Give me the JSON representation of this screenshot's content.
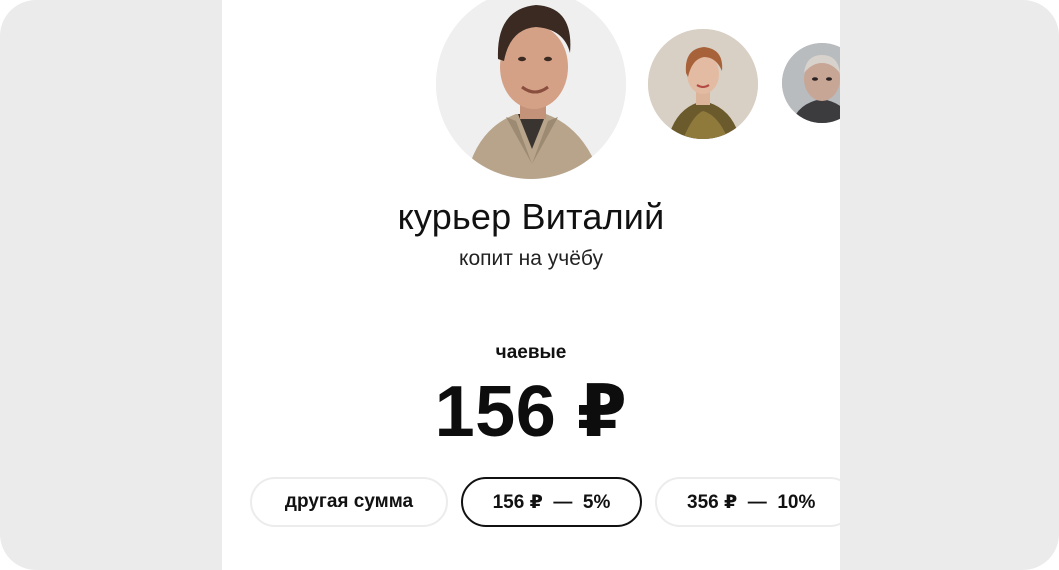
{
  "recipient": {
    "name": "курьер Виталий",
    "goal": "копит на учёбу"
  },
  "tips": {
    "label": "чаевые",
    "amount": "156 ₽"
  },
  "options": [
    {
      "label": "другая сумма",
      "selected": false
    },
    {
      "label": "156 ₽  —  5%",
      "selected": true
    },
    {
      "label": "356 ₽  —  10%",
      "selected": false
    }
  ],
  "colors": {
    "outer_background": "#ebebeb",
    "card_background": "#ffffff",
    "text": "#111111",
    "chip_border": "#ececec",
    "chip_selected_border": "#111111"
  }
}
